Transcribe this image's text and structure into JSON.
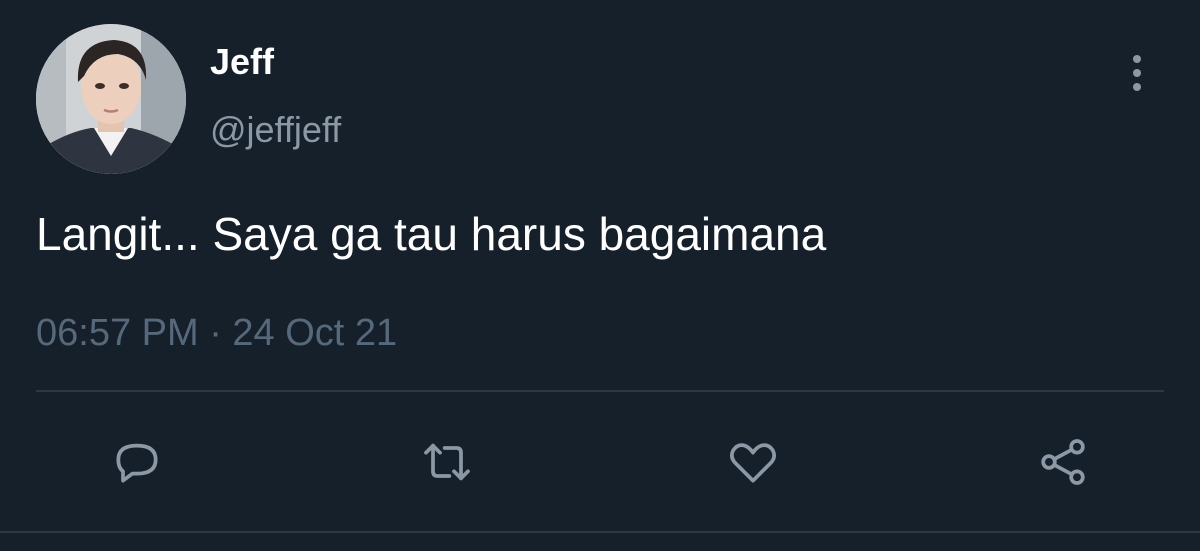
{
  "tweet": {
    "display_name": "Jeff",
    "handle": "@jeffjeff",
    "text": "Langit... Saya ga tau harus bagaimana",
    "timestamp": "06:57 PM · 24 Oct 21"
  },
  "icons": {
    "more": "more-vertical-icon",
    "reply": "reply-icon",
    "retweet": "retweet-icon",
    "like": "heart-icon",
    "share": "share-icon"
  },
  "colors": {
    "background": "#15202b",
    "primary_text": "#ffffff",
    "secondary_text": "#8b98a5",
    "timestamp_text": "#55697b",
    "icon": "#8b98a5",
    "divider": "#2c3944"
  }
}
